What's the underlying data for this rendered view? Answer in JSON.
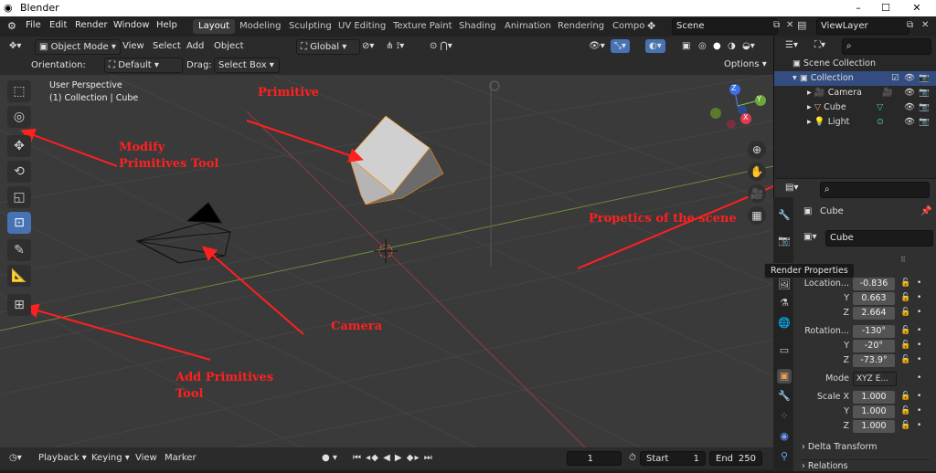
{
  "window": {
    "title": "Blender",
    "minimize": "–",
    "maximize": "☐",
    "close": "✕"
  },
  "menu": [
    "File",
    "Edit",
    "Render",
    "Window",
    "Help"
  ],
  "workspaces": [
    "Layout",
    "Modeling",
    "Sculpting",
    "UV Editing",
    "Texture Paint",
    "Shading",
    "Animation",
    "Rendering",
    "Compo"
  ],
  "scene": {
    "name": "Scene",
    "view_layer": "ViewLayer"
  },
  "viewport_header": {
    "mode": "Object Mode",
    "menus": [
      "View",
      "Select",
      "Add",
      "Object"
    ],
    "transform_orientation": "Global",
    "orientation_label": "Orientation:",
    "orientation_value": "Default",
    "drag_label": "Drag:",
    "drag_value": "Select Box",
    "options": "Options"
  },
  "viewport": {
    "perspective": "User Perspective",
    "collection_info": "(1) Collection | Cube",
    "gizmo": {
      "x": "X",
      "y": "Y",
      "z": "Z"
    }
  },
  "annotations": {
    "primitive": "Primitive",
    "modify_tool_1": "Modify",
    "modify_tool_2": "Primitives Tool",
    "camera": "Camera",
    "add_tool_1": "Add Primitives",
    "add_tool_2": "Tool",
    "properties": "Propetics of the scene"
  },
  "timeline": {
    "menus": [
      "Playback",
      "Keying",
      "View",
      "Marker"
    ],
    "current_frame": "1",
    "start_label": "Start",
    "start": "1",
    "end_label": "End",
    "end": "250"
  },
  "outliner": {
    "rows": [
      {
        "label": "Scene Collection"
      },
      {
        "label": "Collection"
      },
      {
        "label": "Camera"
      },
      {
        "label": "Cube"
      },
      {
        "label": "Light"
      }
    ]
  },
  "properties": {
    "object_name": "Cube",
    "data_name": "Cube",
    "tooltip": "Render Properties",
    "location_label": "Location...",
    "location": {
      "x": "-0.836",
      "y": "0.663",
      "z": "2.664"
    },
    "rotation_label": "Rotation...",
    "rotation": {
      "x": "-130°",
      "y": "-20°",
      "z": "-73.9°"
    },
    "mode_label": "Mode",
    "mode_value": "XYZ E...",
    "scale_label": "Scale X",
    "scale": {
      "x": "1.000",
      "y": "1.000",
      "z": "1.000"
    },
    "axis_y": "Y",
    "axis_z": "Z",
    "delta_transform": "Delta Transform",
    "relations": "Relations"
  }
}
